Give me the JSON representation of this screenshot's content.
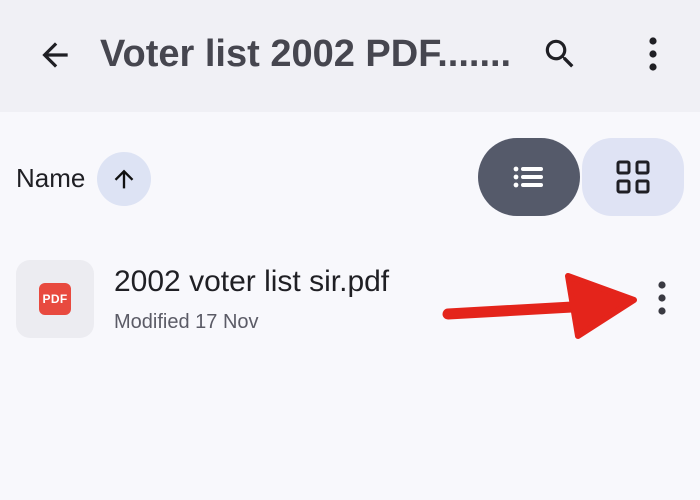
{
  "app_bar": {
    "title": "Voter list 2002 PDF.......",
    "back_icon": "arrow-left-icon",
    "search_icon": "search-icon",
    "more_icon": "more-vertical-icon"
  },
  "sort_bar": {
    "sort_label": "Name",
    "sort_direction": "ascending",
    "view_modes": [
      "list",
      "grid"
    ],
    "active_view": "list"
  },
  "files": [
    {
      "name": "2002 voter list sir.pdf",
      "modified_label": "Modified",
      "modified_date": "17 Nov",
      "type_badge": "PDF"
    }
  ],
  "annotation": {
    "type": "arrow",
    "color": "#e4241b",
    "points_to": "file-more-button"
  },
  "colors": {
    "app_bar_bg": "#f0f0f5",
    "page_bg": "#f8f8fc",
    "active_view_bg": "#555a6a",
    "inactive_view_bg": "#dfe3f4",
    "pdf_red": "#e84a3f"
  }
}
